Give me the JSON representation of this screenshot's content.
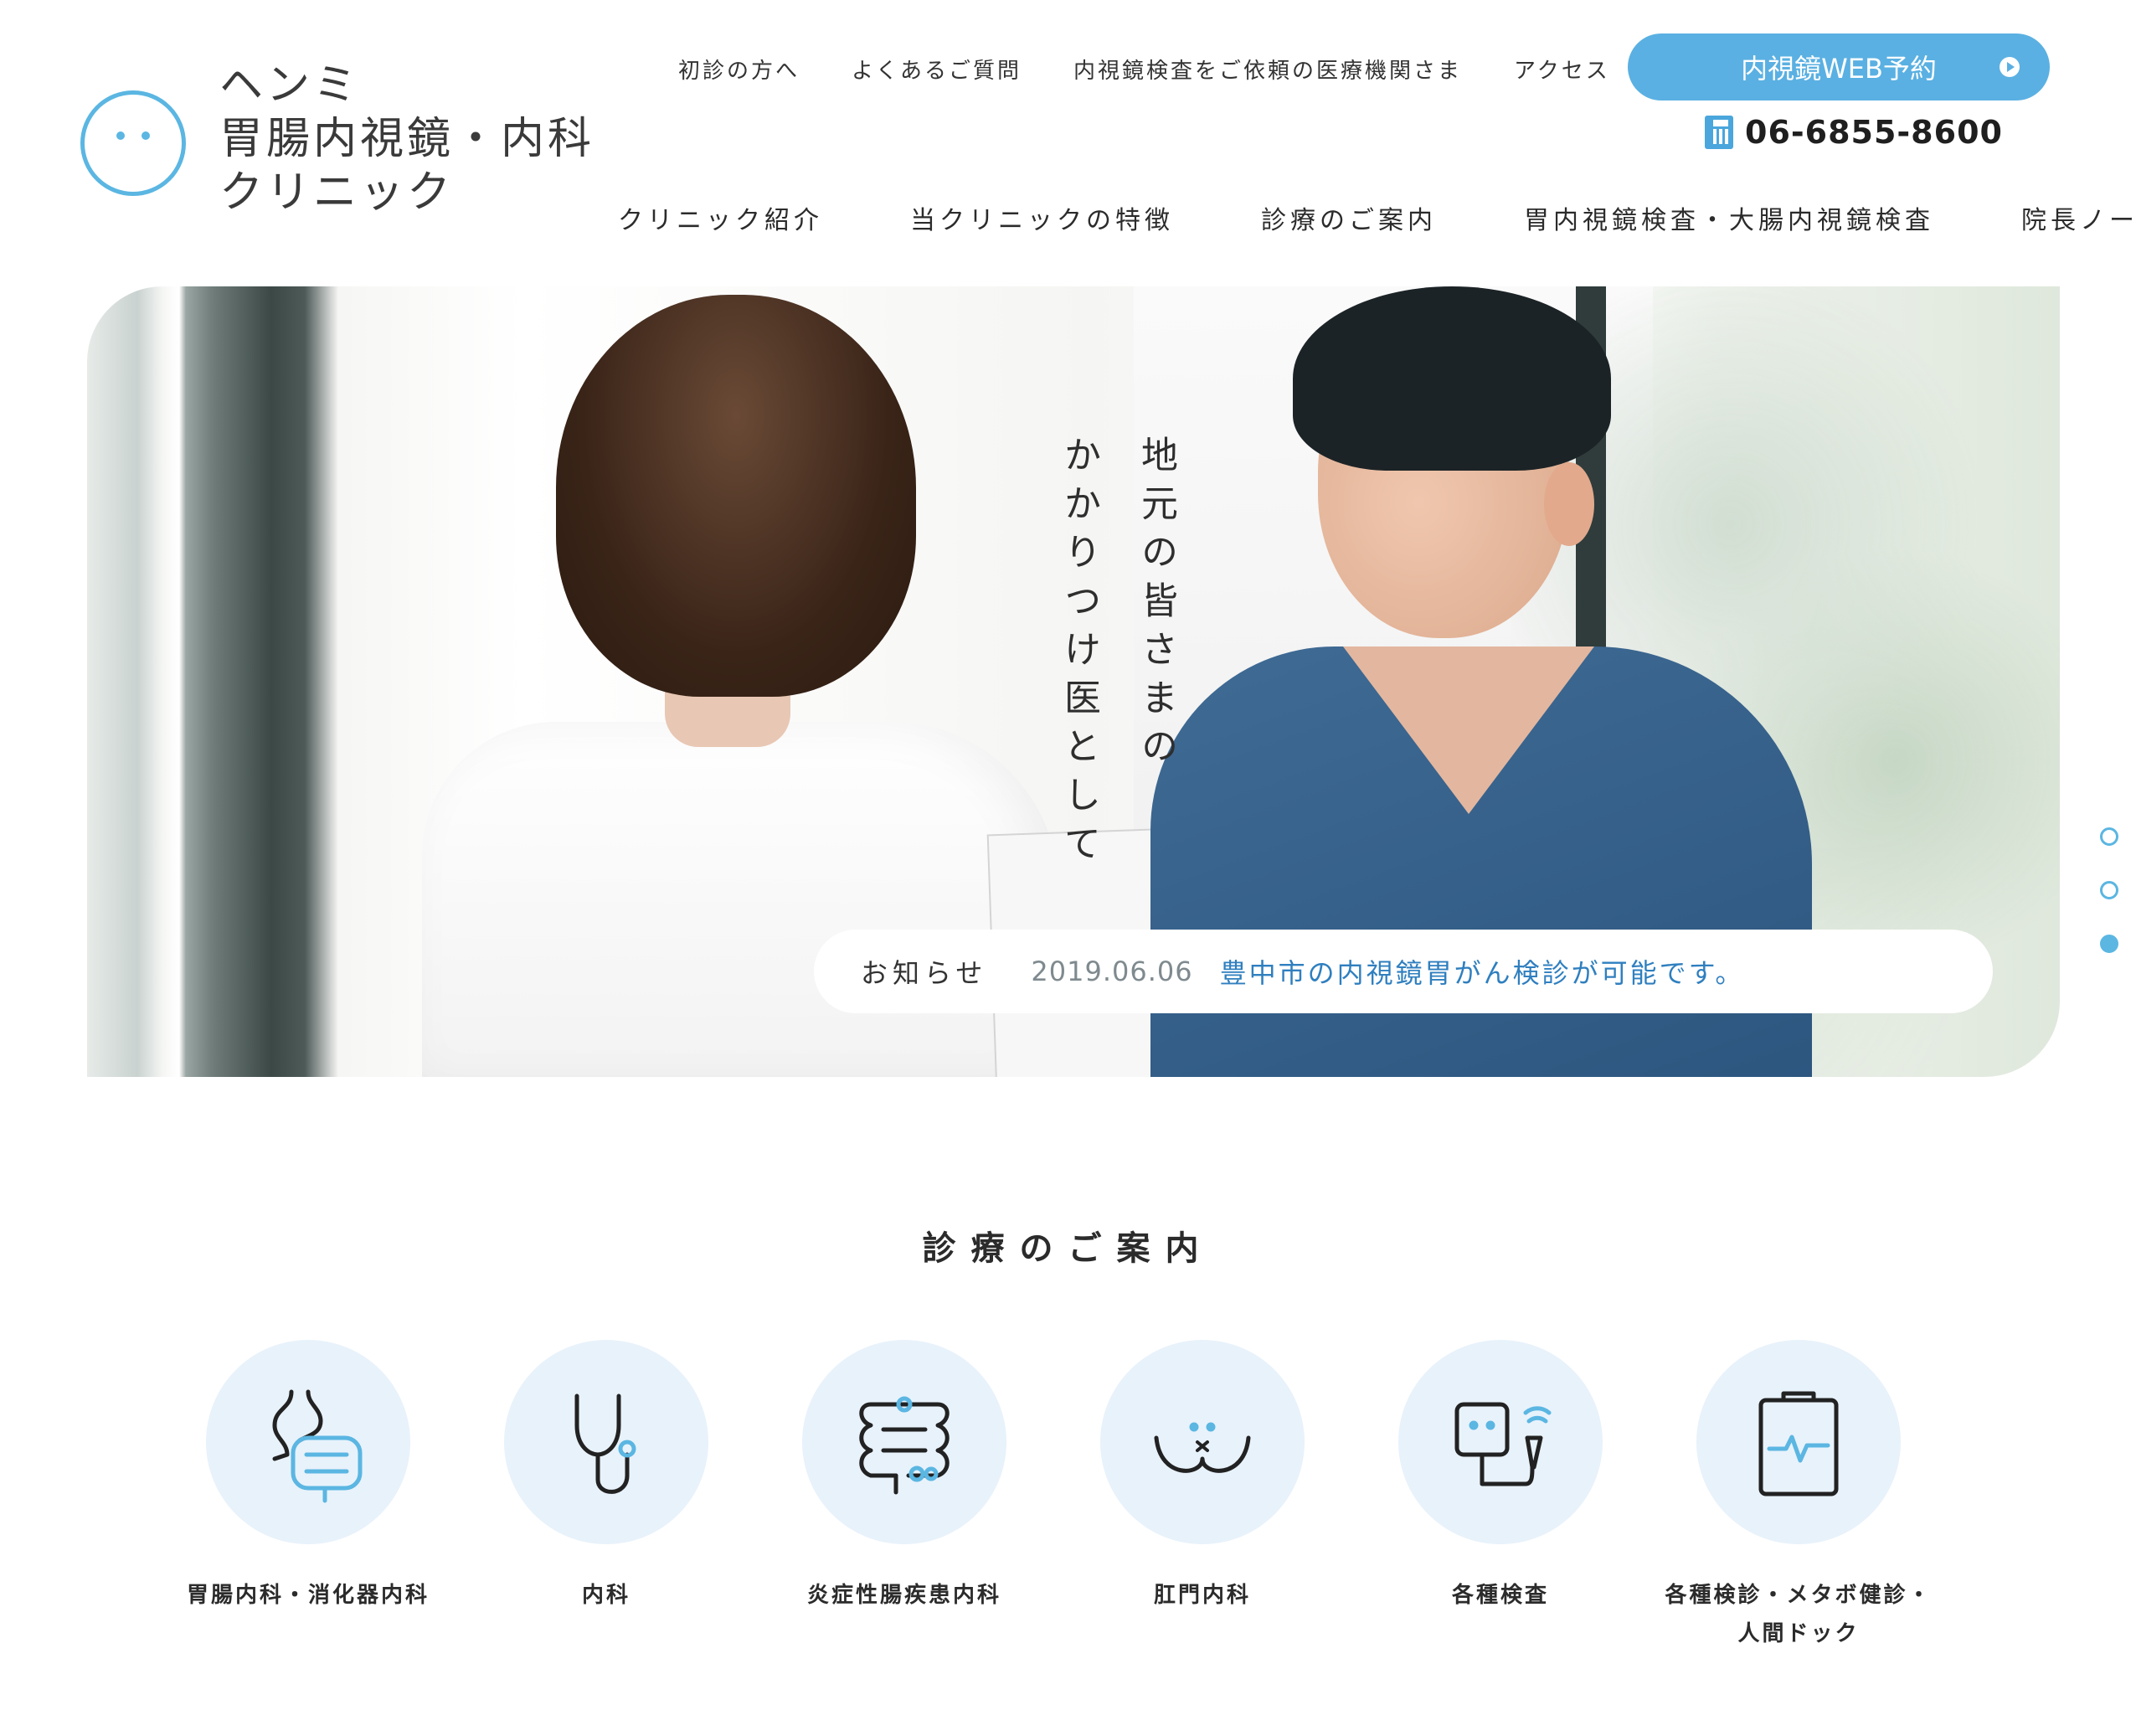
{
  "logo": {
    "line1": "ヘンミ",
    "line2": "胃腸内視鏡・内科",
    "line3": "クリニック"
  },
  "topnav": {
    "items": [
      "初診の方へ",
      "よくあるご質問",
      "内視鏡検査をご依頼の医療機関さま",
      "アクセス"
    ]
  },
  "reservation_button": "内視鏡WEB予約",
  "phone": "06-6855-8600",
  "mainnav": {
    "items": [
      "クリニック紹介",
      "当クリニックの特徴",
      "診療のご案内",
      "胃内視鏡検査・大腸内視鏡検査",
      "院長ノート"
    ]
  },
  "hero": {
    "copy_line1": "地元の皆さまの",
    "copy_line2": "かかりつけ医として",
    "slide_count": 3,
    "active_slide": 3
  },
  "notice": {
    "label": "お知らせ",
    "date": "2019.06.06",
    "text": "豊中市の内視鏡胃がん検診が可能です。"
  },
  "services": {
    "title": "診療のご案内",
    "items": [
      {
        "label": "胃腸内科・消化器内科",
        "icon": "stomach-intestine-icon"
      },
      {
        "label": "内科",
        "icon": "stethoscope-icon"
      },
      {
        "label": "炎症性腸疾患内科",
        "icon": "colon-icon"
      },
      {
        "label": "肛門内科",
        "icon": "buttocks-icon"
      },
      {
        "label": "各種検査",
        "icon": "ultrasound-icon"
      },
      {
        "label": "各種検診・メタボ健診・",
        "label2": "人間ドック",
        "icon": "clipboard-pulse-icon"
      }
    ]
  },
  "colors": {
    "accent": "#5bb6e2",
    "button": "#5ab0e2",
    "link": "#2f7fbf",
    "icon_circle": "#e8f2fb"
  }
}
